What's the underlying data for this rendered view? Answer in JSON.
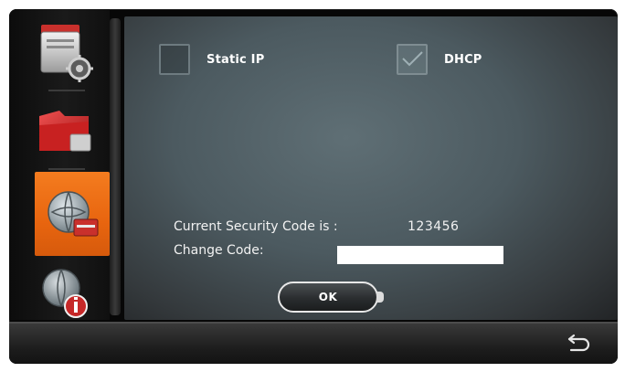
{
  "network": {
    "static_ip_label": "Static IP",
    "static_ip_checked": false,
    "dhcp_label": "DHCP",
    "dhcp_checked": true
  },
  "security": {
    "current_label": "Current Security Code is :",
    "current_value": "123456",
    "change_label": "Change Code:",
    "change_input_value": ""
  },
  "actions": {
    "ok_label": "OK"
  },
  "sidebar": {
    "items": [
      {
        "icon": "settings-gear-icon",
        "active": false
      },
      {
        "icon": "red-folder-icon",
        "active": false
      },
      {
        "icon": "network-globe-icon",
        "active": true
      },
      {
        "icon": "info-globe-icon",
        "active": false
      }
    ]
  },
  "colors": {
    "active_tab": "#f47c1f",
    "panel": "#4c5a60"
  }
}
